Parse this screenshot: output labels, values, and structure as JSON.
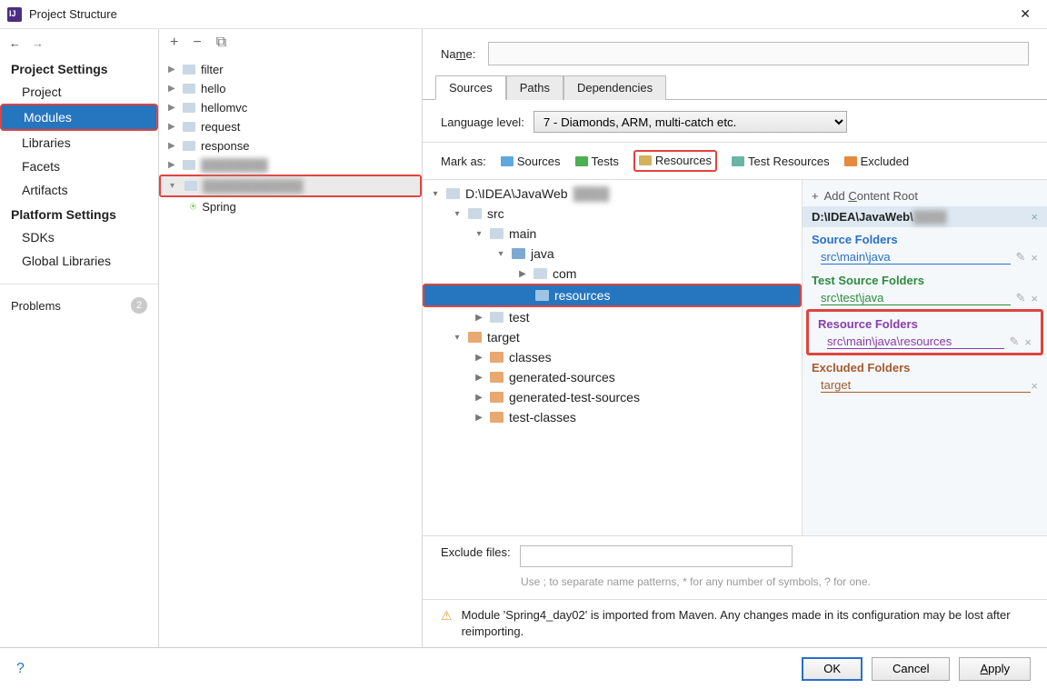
{
  "window": {
    "title": "Project Structure"
  },
  "nav": {
    "project_settings_label": "Project Settings",
    "items_ps": [
      "Project",
      "Modules",
      "Libraries",
      "Facets",
      "Artifacts"
    ],
    "platform_settings_label": "Platform Settings",
    "items_pf": [
      "SDKs",
      "Global Libraries"
    ],
    "problems_label": "Problems",
    "problems_count": "2"
  },
  "modules": {
    "nodes": [
      "filter",
      "hello",
      "hellomvc",
      "request",
      "response"
    ],
    "spring_label": "Spring"
  },
  "name": {
    "label_pre": "Na",
    "label_und": "m",
    "label_post": "e:",
    "value": ""
  },
  "tabs": {
    "sources": "Sources",
    "paths": "Paths",
    "deps": "Dependencies"
  },
  "language": {
    "label": "Language level:",
    "value": "7 - Diamonds, ARM, multi-catch etc."
  },
  "mark": {
    "label": "Mark as:",
    "sources": "Sources",
    "tests": "Tests",
    "resources": "Resources",
    "test_resources": "Test Resources",
    "excluded": "Excluded"
  },
  "dirtree": {
    "root": "D:\\IDEA\\JavaWeb",
    "src": "src",
    "main": "main",
    "java": "java",
    "com": "com",
    "resources": "resources",
    "test": "test",
    "target": "target",
    "classes": "classes",
    "gen_src": "generated-sources",
    "gen_test": "generated-test-sources",
    "test_classes": "test-classes"
  },
  "side": {
    "add_root": "Add Content Root",
    "root_path": "D:\\IDEA\\JavaWeb\\",
    "source_folders": "Source Folders",
    "src_main_java": "src\\main\\java",
    "test_source_folders": "Test Source Folders",
    "src_test_java": "src\\test\\java",
    "resource_folders": "Resource Folders",
    "src_main_java_resources": "src\\main\\java\\resources",
    "excluded_folders": "Excluded Folders",
    "target": "target"
  },
  "exclude": {
    "label": "Exclude files:",
    "hint": "Use ; to separate name patterns, * for any number of symbols, ? for one."
  },
  "warning": "Module 'Spring4_day02' is imported from Maven. Any changes made in its configuration may be lost after reimporting.",
  "footer": {
    "ok": "OK",
    "cancel": "Cancel",
    "apply": "Apply"
  }
}
